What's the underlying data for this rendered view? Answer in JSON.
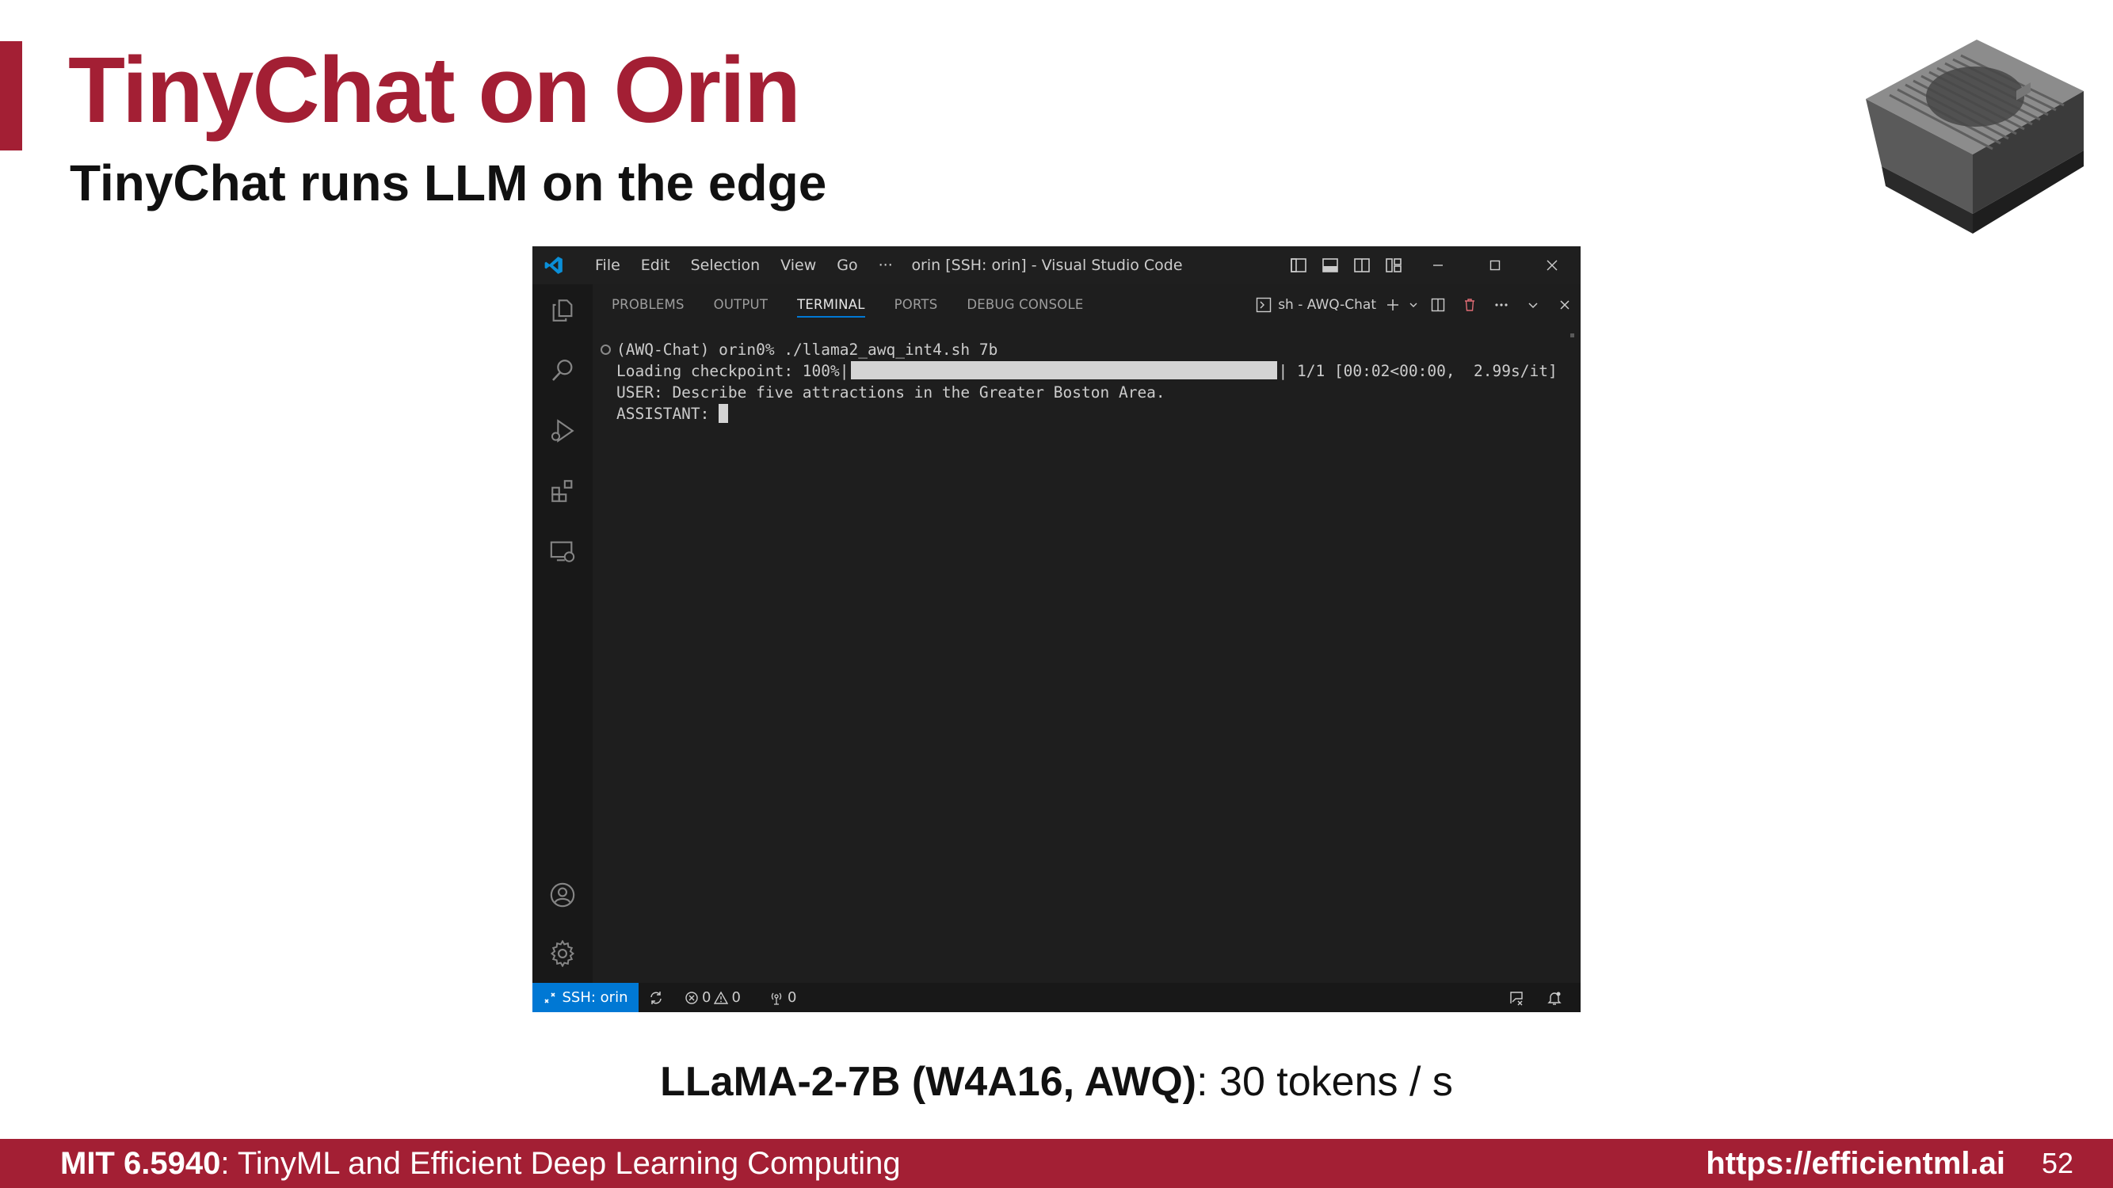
{
  "slide": {
    "title": "TinyChat on Orin",
    "subtitle": "TinyChat runs LLM on the edge",
    "caption_bold": "LLaMA-2-7B (W4A16, AWQ)",
    "caption_rest": ": 30 tokens / s"
  },
  "footer": {
    "course_code": "MIT 6.5940",
    "course_name": ": TinyML and Efficient Deep Learning Computing",
    "url": "https://efficientml.ai",
    "page_number": "52"
  },
  "vscode": {
    "menu": [
      "File",
      "Edit",
      "Selection",
      "View",
      "Go",
      "···"
    ],
    "window_title": "orin [SSH: orin] - Visual Studio Code",
    "panel_tabs": [
      "PROBLEMS",
      "OUTPUT",
      "TERMINAL",
      "PORTS",
      "DEBUG CONSOLE"
    ],
    "active_tab": "TERMINAL",
    "terminal_name": "sh - AWQ-Chat",
    "terminal_lines": {
      "command": "(AWQ-Chat) orin0% ./llama2_awq_int4.sh 7b",
      "loading_prefix": "Loading checkpoint: 100%|",
      "loading_suffix": "| 1/1 [00:02<00:00,  2.99s/it]",
      "loading_progress": 1.0,
      "user": "USER: Describe five attractions in the Greater Boston Area.",
      "assistant": "ASSISTANT: "
    },
    "status": {
      "remote_label": "SSH: orin",
      "errors": "0",
      "warnings": "0",
      "ports": "0"
    }
  },
  "colors": {
    "brand": "#a31f34",
    "vscode_accent": "#0078d4",
    "editor_bg": "#1e1e1e"
  }
}
